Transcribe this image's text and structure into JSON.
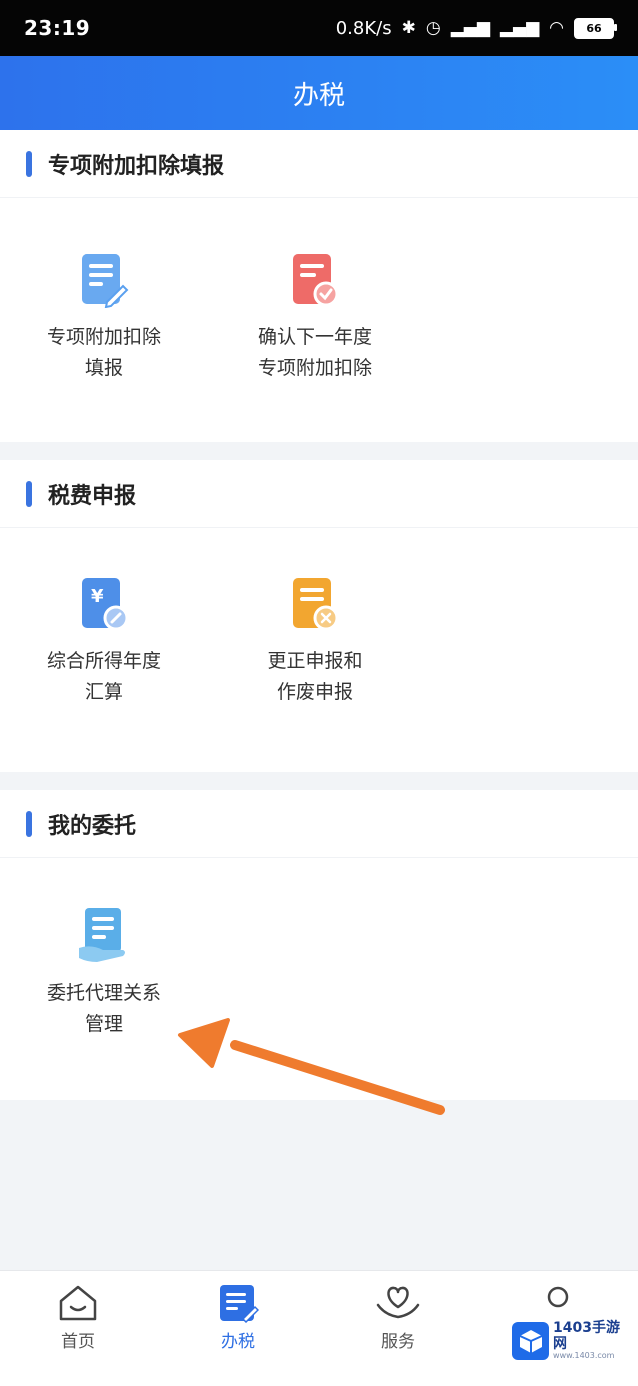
{
  "status": {
    "time": "23:19",
    "speed": "0.8K/s",
    "battery": "66"
  },
  "header": {
    "title": "办税"
  },
  "sections": [
    {
      "title": "专项附加扣除填报",
      "items": [
        {
          "label": "专项附加扣除\n填报",
          "icon": "document-edit-icon"
        },
        {
          "label": "确认下一年度\n专项附加扣除",
          "icon": "document-check-icon"
        }
      ]
    },
    {
      "title": "税费申报",
      "items": [
        {
          "label": "综合所得年度\n汇算",
          "icon": "yuan-document-icon"
        },
        {
          "label": "更正申报和\n作废申报",
          "icon": "document-delete-icon"
        }
      ]
    },
    {
      "title": "我的委托",
      "items": [
        {
          "label": "委托代理关系\n管理",
          "icon": "document-hand-icon"
        }
      ]
    }
  ],
  "tabs": [
    {
      "label": "首页",
      "icon": "home-icon"
    },
    {
      "label": "办税",
      "icon": "tax-document-icon",
      "active": true
    },
    {
      "label": "服务",
      "icon": "heart-hand-icon"
    },
    {
      "label": "",
      "icon": "user-icon"
    }
  ],
  "watermark": {
    "main": "1403手游网",
    "sub": "www.1403.com"
  },
  "colors": {
    "accent": "#2e6fe3",
    "annotation_arrow": "#ef7b2e"
  }
}
